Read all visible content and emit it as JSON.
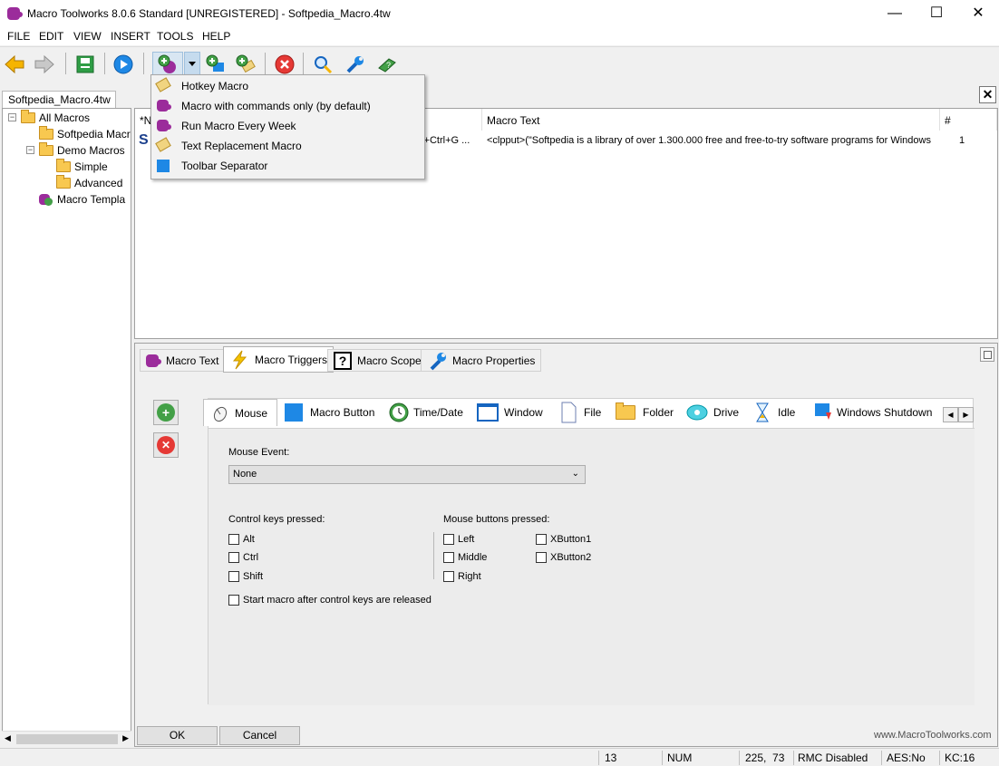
{
  "window": {
    "title": "Macro Toolworks 8.0.6 Standard [UNREGISTERED] - Softpedia_Macro.4tw",
    "minimize": "—",
    "maximize": "☐",
    "close": "✕"
  },
  "menu": [
    "FILE",
    "EDIT",
    "VIEW",
    "INSERT",
    "TOOLS",
    "HELP"
  ],
  "toolbar": {
    "icons": [
      "back-arrow-icon",
      "forward-arrow-icon",
      "save-icon",
      "play-icon",
      "add-macro-icon",
      "add-macro-dropdown-icon",
      "add-macro-2-icon",
      "add-macro-3-icon",
      "delete-icon",
      "search-icon",
      "wrench-icon",
      "help-book-icon"
    ]
  },
  "dropdown": {
    "items": [
      {
        "label": "Hotkey Macro",
        "icon": "tag-icon"
      },
      {
        "label": "Macro with commands only (by default)",
        "icon": "puzzle-icon"
      },
      {
        "label": "Run Macro Every Week",
        "icon": "puzzle-icon"
      },
      {
        "label": "Text Replacement Macro",
        "icon": "tag-icon"
      },
      {
        "label": "Toolbar Separator",
        "icon": "separator-icon"
      }
    ]
  },
  "doc_tab": {
    "label": "Softpedia_Macro.4tw",
    "close": "✕"
  },
  "tree": {
    "nodes": [
      {
        "label": "All Macros"
      },
      {
        "label": "Softpedia Macr"
      },
      {
        "label": "Demo Macros"
      },
      {
        "label": "Simple"
      },
      {
        "label": "Advanced"
      },
      {
        "label": "Macro Templa"
      }
    ]
  },
  "list": {
    "headers": {
      "name": "*N",
      "macro_text": "Macro Text",
      "count": "#"
    },
    "rows": [
      {
        "name_prefix": "S",
        "trigger": "ift+Ctrl+G ...",
        "macro_text": "<clpput>(\"Softpedia is a library of over 1.300.000 free and free-to-try software programs for Windows a...",
        "count": "1"
      }
    ]
  },
  "outer_tabs": [
    {
      "label": "Macro Text"
    },
    {
      "label": "Macro Triggers"
    },
    {
      "label": "Macro Scope"
    },
    {
      "label": "Macro Properties"
    }
  ],
  "inner_tabs": [
    {
      "label": "Mouse"
    },
    {
      "label": "Macro Button"
    },
    {
      "label": "Time/Date"
    },
    {
      "label": "Window"
    },
    {
      "label": "File"
    },
    {
      "label": "Folder"
    },
    {
      "label": "Drive"
    },
    {
      "label": "Idle"
    },
    {
      "label": "Windows Shutdown"
    }
  ],
  "mouse": {
    "event_label": "Mouse Event:",
    "event_value": "None",
    "control_keys_label": "Control keys pressed:",
    "control_keys": [
      "Alt",
      "Ctrl",
      "Shift"
    ],
    "mouse_buttons_label": "Mouse buttons pressed:",
    "mouse_buttons_col1": [
      "Left",
      "Middle",
      "Right"
    ],
    "mouse_buttons_col2": [
      "XButton1",
      "XButton2"
    ],
    "start_after_release": "Start macro after control keys are released"
  },
  "buttons": {
    "ok": "OK",
    "cancel": "Cancel"
  },
  "website": "www.MacroToolworks.com",
  "status": {
    "count": "13",
    "num": "NUM",
    "coords": "225,  73",
    "rmc": "RMC Disabled",
    "aes": "AES:No",
    "kc": "KC:16"
  },
  "colors": {
    "accent_purple": "#9b2c9b",
    "play_blue": "#1e88e5",
    "delete_red": "#e53935",
    "add_green": "#43a047"
  }
}
